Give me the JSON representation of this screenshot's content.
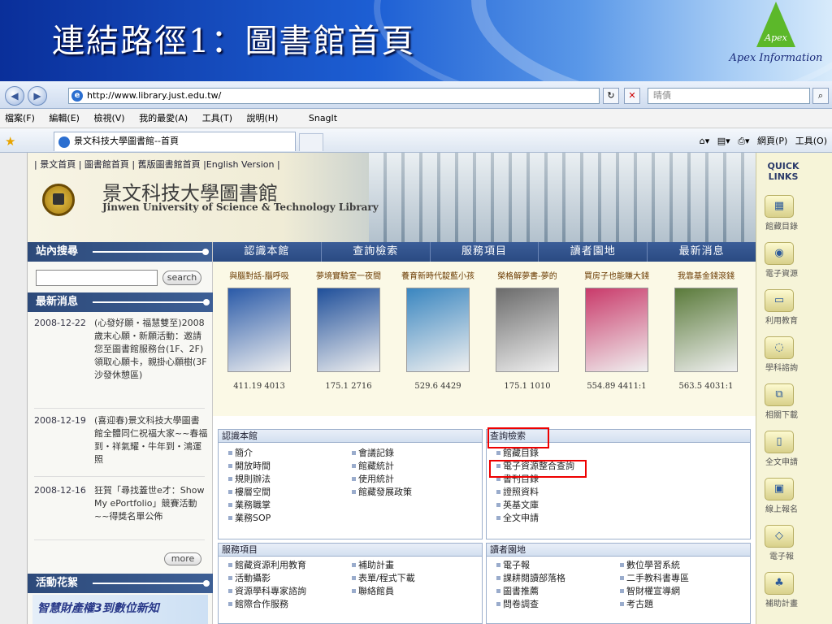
{
  "slide": {
    "title": "連結路徑1：圖書館首頁",
    "logo_word": "Apex",
    "logo_text": "Apex Information"
  },
  "browser": {
    "url": "http://www.library.just.edu.tw/",
    "search_text": "晴債",
    "menu": [
      "檔案(F)",
      "編輯(E)",
      "檢視(V)",
      "我的最愛(A)",
      "工具(T)",
      "說明(H)",
      "SnagIt"
    ],
    "tab_title": "景文科技大學圖書館--首頁",
    "toolbar_page": "網頁(P)",
    "toolbar_tools": "工具(O)"
  },
  "site": {
    "top_links": "| 景文首頁 | 圖書館首頁 | 舊版圖書館首頁 |English Version |",
    "library_name_zh": "景文科技大學圖書館",
    "library_name_en": "Jinwen University of Science & Technology Library",
    "search_heading": "站內搜尋",
    "search_button": "search",
    "news_heading": "最新消息",
    "news": [
      {
        "date": "2008-12-22",
        "text": "(心發好願・福慧雙至)2008歲末心願・新願活動：邀請您至圖書館服務台(1F、2F)領取心願卡，親掛心願樹(3F沙發休憩區)"
      },
      {
        "date": "2008-12-19",
        "text": "(喜迎春)景文科技大學圖書館全體同仁祝福大家~~春福到・祥氣耀・牛年到・鴻運照"
      },
      {
        "date": "2008-12-16",
        "text": "狂賀「尋找蓋世e才：Show My ePortfolio」競賽活動~~得獎名單公佈"
      }
    ],
    "more_button": "more",
    "activity_heading": "活動花絮",
    "activity_banner": "智慧財產權3到數位新知",
    "nav": [
      "認識本館",
      "查詢檢索",
      "服務項目",
      "讀者園地",
      "最新消息"
    ],
    "books": [
      {
        "title": "與腦對話-腦呼吸",
        "call": "411.19 4013",
        "color": "#2a5aa8"
      },
      {
        "title": "夢境實驗室一夜間",
        "call": "175.1 2716",
        "color": "#1f4f9a"
      },
      {
        "title": "養育新時代靛藍小孩",
        "call": "529.6 4429",
        "color": "#3a86c0"
      },
      {
        "title": "榮格解夢書-夢的",
        "call": "175.1 1010",
        "color": "#6b6b6b"
      },
      {
        "title": "買房子也能賺大錢",
        "call": "554.89 4411:1",
        "color": "#c93a6a"
      },
      {
        "title": "我靠基金錢滾錢",
        "call": "563.5 4031:1",
        "color": "#5a7a3a"
      }
    ],
    "box_about": {
      "title": "認識本館",
      "col1": [
        "簡介",
        "開放時間",
        "規則辦法",
        "樓層空間",
        "業務職掌",
        "業務SOP"
      ],
      "col2": [
        "會議記錄",
        "館藏統計",
        "使用統計",
        "館藏發展政策"
      ]
    },
    "box_search": {
      "title": "查詢檢索",
      "items": [
        "館藏目錄",
        "電子資源整合查詢",
        "書刊目錄",
        "證照資料",
        "英基文庫",
        "全文申請"
      ]
    },
    "box_service": {
      "title": "服務項目",
      "col1": [
        "館藏資源利用教育",
        "活動攝影",
        "資源學科專家諮詢",
        "館際合作服務"
      ],
      "col2": [
        "補助計畫",
        "表單/程式下載",
        "聯絡館員"
      ]
    },
    "box_reader": {
      "title": "讀者園地",
      "col1": [
        "電子報",
        "課耕閱讀部落格",
        "圖書推薦",
        "問卷調查"
      ],
      "col2": [
        "數位學習系統",
        "二手教科書專區",
        "智財權宣導網",
        "考古題"
      ]
    },
    "quick_links": {
      "title": "QUICK LINKS",
      "items": [
        "館藏目錄",
        "電子資源",
        "利用教育",
        "學科諮詢",
        "相關下載",
        "全文申請",
        "線上報名",
        "電子報",
        "補助計畫"
      ]
    }
  }
}
